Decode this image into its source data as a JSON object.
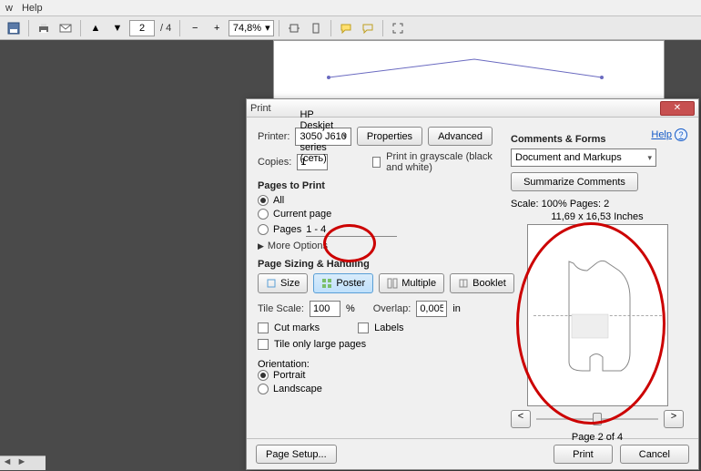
{
  "menu": {
    "item1": "w",
    "item2": "Help"
  },
  "toolbar": {
    "page_current": "2",
    "page_total": "/ 4",
    "zoom": "74,8%"
  },
  "dialog": {
    "title": "Print",
    "help": "Help",
    "printer_label": "Printer:",
    "printer_value": "HP Deskjet 3050 J610 series (сеть)",
    "properties": "Properties",
    "advanced": "Advanced",
    "copies_label": "Copies:",
    "copies_value": "1",
    "grayscale": "Print in grayscale (black and white)",
    "pages_head": "Pages to Print",
    "all": "All",
    "current": "Current page",
    "pages": "Pages",
    "pages_range": "1 - 4",
    "more": "More Options",
    "sizing_head": "Page Sizing & Handling",
    "tab_size": "Size",
    "tab_poster": "Poster",
    "tab_multiple": "Multiple",
    "tab_booklet": "Booklet",
    "tile_scale_label": "Tile Scale:",
    "tile_scale_value": "100",
    "tile_pct": "%",
    "overlap_label": "Overlap:",
    "overlap_value": "0,005",
    "overlap_unit": "in",
    "cut_marks": "Cut marks",
    "labels": "Labels",
    "tile_large": "Tile only large pages",
    "orient_head": "Orientation:",
    "portrait": "Portrait",
    "landscape": "Landscape",
    "comments_head": "Comments & Forms",
    "comments_value": "Document and Markups",
    "summarize": "Summarize Comments",
    "scale_txt": "Scale: 100% Pages: 2",
    "dims": "11,69 x 16,53 Inches",
    "page_of": "Page 2 of 4",
    "page_setup": "Page Setup...",
    "print": "Print",
    "cancel": "Cancel"
  }
}
